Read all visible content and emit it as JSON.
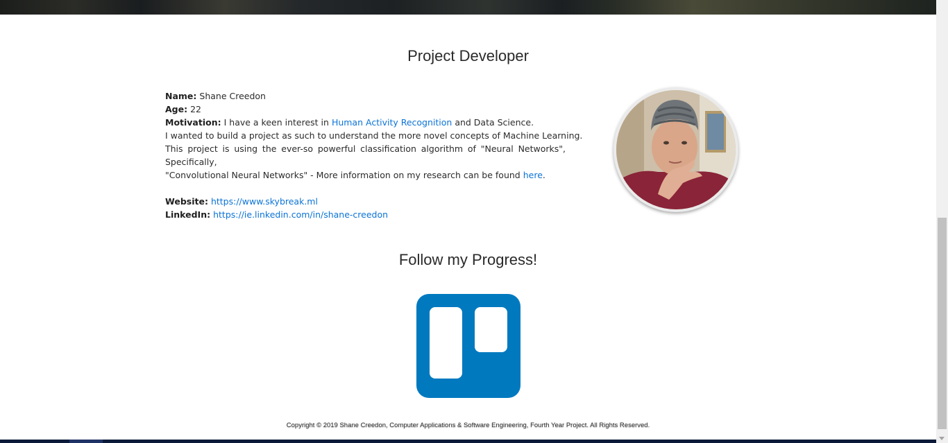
{
  "developer": {
    "heading": "Project Developer",
    "name_label": "Name:",
    "name_value": "Shane Creedon",
    "age_label": "Age:",
    "age_value": "22",
    "motivation_label": "Motivation:",
    "motivation_prefix": "I have a keen interest in",
    "har_link": "Human Activity Recognition",
    "motivation_suffix": "and Data Science.",
    "line2": "I wanted to build a project as such to understand the more novel concepts of Machine Learning.",
    "line3": "This project is using the ever-so powerful classification algorithm of \"Neural Networks\", Specifically,",
    "line4_prefix": "\"Convolutional Neural Networks\" - More information on my research can be found",
    "here_link": "here",
    "line4_suffix": ".",
    "website_label": "Website:",
    "website_url": "https://www.skybreak.ml",
    "linkedin_label": "LinkedIn:",
    "linkedin_url": "https://ie.linkedin.com/in/shane-creedon",
    "avatar_icon": "profile-photo"
  },
  "progress": {
    "heading": "Follow my Progress!",
    "trello_icon": "trello-logo-icon",
    "trello_color": "#0079bf"
  },
  "footer": {
    "copyright": "Copyright © 2019 Shane Creedon, Computer Applications & Software Engineering, Fourth Year Project. All Rights Reserved."
  },
  "colors": {
    "link": "#0b73d6",
    "text": "#2b2b2b"
  }
}
